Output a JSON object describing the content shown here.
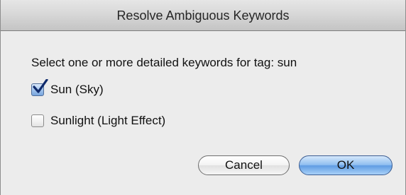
{
  "dialog": {
    "title": "Resolve Ambiguous Keywords",
    "prompt": "Select one or more detailed keywords for tag: sun",
    "options": [
      {
        "label": "Sun (Sky)",
        "checked": true
      },
      {
        "label": "Sunlight (Light Effect)",
        "checked": false
      }
    ],
    "buttons": {
      "cancel_label": "Cancel",
      "ok_label": "OK"
    }
  },
  "colors": {
    "accent": "#6aa3e6",
    "checkmark": "#0f2a6b",
    "window_background": "#ececec"
  }
}
